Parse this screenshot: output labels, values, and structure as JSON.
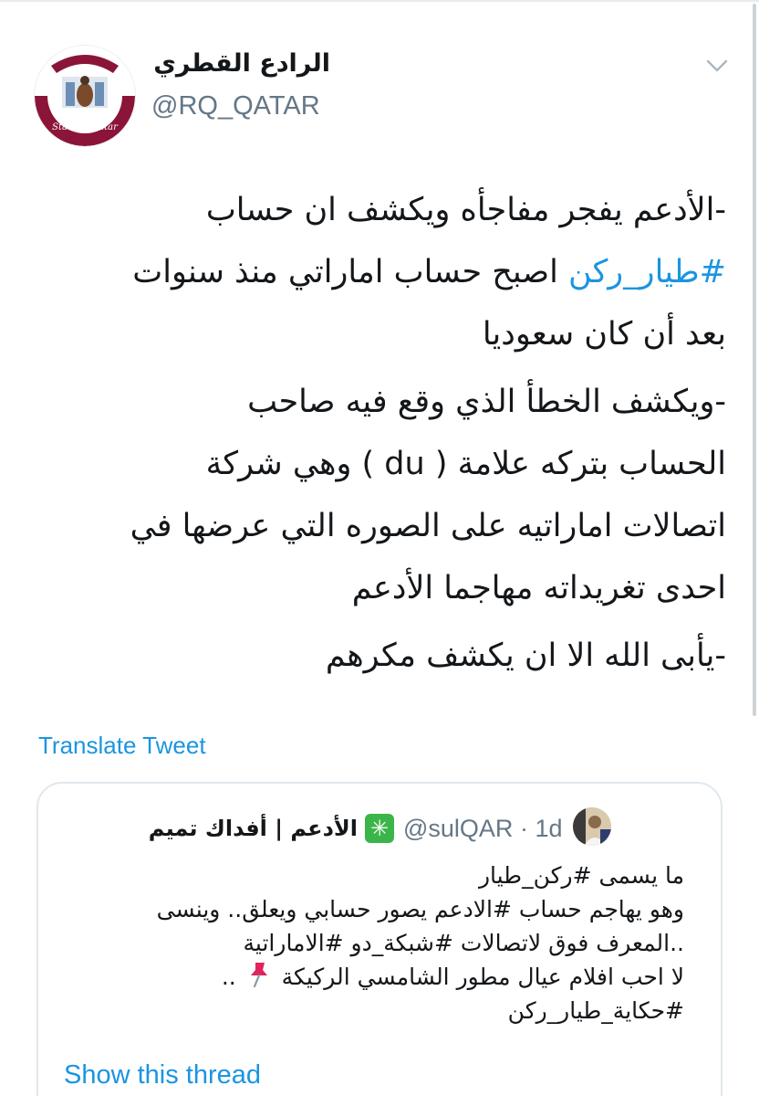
{
  "tweet": {
    "author": {
      "name": "الرادع القطري",
      "handle": "@RQ_QATAR",
      "avatar_alt_text": "State of Qatar"
    },
    "menu_icon": "chevron-down-icon",
    "paragraphs": [
      {
        "lines": [
          [
            {
              "text": "-الأدعم يفجر مفاجأه ويكشف ان حساب"
            }
          ],
          [
            {
              "text": "#طيار_ركن",
              "hashtag": true
            },
            {
              "text": " اصبح حساب اماراتي منذ سنوات"
            }
          ],
          [
            {
              "text": "بعد أن كان سعوديا"
            }
          ]
        ]
      },
      {
        "lines": [
          [
            {
              "text": "-ويكشف الخطأ الذي وقع فيه صاحب"
            }
          ],
          [
            {
              "text": "الحساب بتركه علامة ( du ) وهي شركة"
            }
          ],
          [
            {
              "text": "اتصالات اماراتيه على الصوره التي عرضها في"
            }
          ],
          [
            {
              "text": "احدى تغريداته مهاجما الأدعم"
            }
          ]
        ]
      },
      {
        "lines": [
          [
            {
              "text": "-يأبى الله الا ان يكشف مكرهم"
            }
          ]
        ]
      }
    ],
    "translate_label": "Translate Tweet"
  },
  "quoted_tweet": {
    "name": "الأدعم | أفداك تميم",
    "badge_icon": "sparkle-badge-icon",
    "handle": "@sulQAR",
    "separator": "·",
    "time": "1d",
    "lines": [
      "ما يسمى #ركن_طيار",
      "وهو يهاجم حساب #الادعم يصور حسابي ويعلق.. وينسى",
      "..المعرف فوق لاتصالات #شبكة_دو #الاماراتية",
      "لا احب افلام عيال مطور الشامسي الركيكة"
    ],
    "pin_line_prefix": "..",
    "last_line": "#حكاية_طيار_ركن",
    "show_thread_label": "Show this thread"
  },
  "colors": {
    "link": "#1b95e0",
    "text": "#14171a",
    "secondary": "#657786",
    "border": "#e1e8ed",
    "avatar_maroon": "#8a1538"
  }
}
